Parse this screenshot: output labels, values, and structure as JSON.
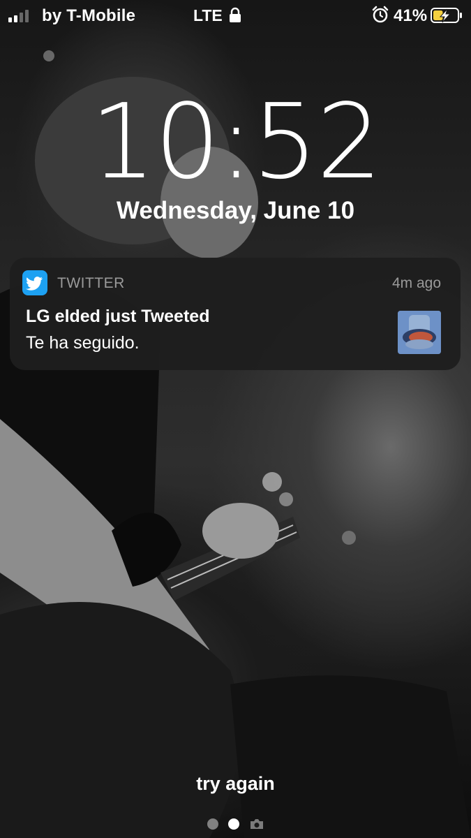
{
  "status_bar": {
    "carrier": "by T-Mobile",
    "network": "LTE",
    "battery_percent": "41%",
    "signal_bars_filled": 2,
    "battery_level": 0.41,
    "icons": [
      "signal-icon",
      "lock-icon",
      "alarm-icon",
      "battery-charging-icon"
    ]
  },
  "lock_screen": {
    "time": "10:52",
    "date": "Wednesday, June 10"
  },
  "notification": {
    "app_name": "TWITTER",
    "time_ago": "4m ago",
    "title": "LG elded just Tweeted",
    "body": "Te ha seguido.",
    "app_icon": "twitter-bird-icon",
    "accent_color": "#1DA1F2"
  },
  "footer": {
    "hint": "try again",
    "pages": 3,
    "active_page": 2
  }
}
